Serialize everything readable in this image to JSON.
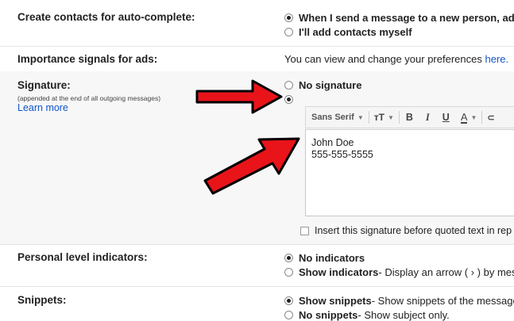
{
  "rows": {
    "create_contacts": {
      "label": "Create contacts for auto-complete:",
      "options": [
        {
          "label": "When I send a message to a new person, add",
          "selected": true
        },
        {
          "label": "I'll add contacts myself",
          "selected": false
        }
      ]
    },
    "importance_signals": {
      "label": "Importance signals for ads:",
      "text": "You can view and change your preferences ",
      "link": "here."
    },
    "signature": {
      "label": "Signature:",
      "note": "(appended at the end of all outgoing messages)",
      "learn_more": "Learn more",
      "no_signature": "No signature",
      "toolbar": {
        "font": "Sans Serif",
        "size_icon": "ᴛT",
        "bold": "B",
        "italic": "I",
        "underline": "U",
        "text_color": "A",
        "link_icon": "⊂"
      },
      "editor_lines": [
        "John Doe",
        "555-555-5555"
      ],
      "insert_before_quoted": "Insert this signature before quoted text in rep"
    },
    "personal_level": {
      "label": "Personal level indicators:",
      "no_indicators": "No indicators",
      "show_indicators": "Show indicators",
      "show_indicators_desc": " - Display an arrow ( › ) by mes"
    },
    "snippets": {
      "label": "Snippets:",
      "show_snippets": "Show snippets",
      "show_snippets_desc": " - Show snippets of the message",
      "no_snippets": "No snippets",
      "no_snippets_desc": " - Show subject only."
    }
  },
  "colors": {
    "link": "#1155cc",
    "arrow": "#e8141a"
  }
}
